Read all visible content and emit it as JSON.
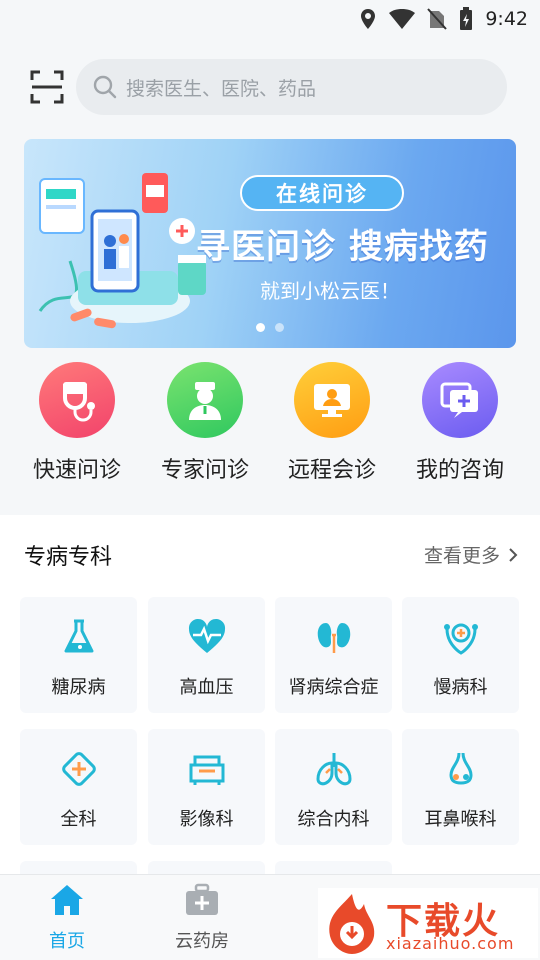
{
  "status_bar": {
    "time": "9:42"
  },
  "search": {
    "placeholder": "搜索医生、医院、药品"
  },
  "banner": {
    "tag": "在线问诊",
    "title": "寻医问诊 搜病找药",
    "subtitle": "就到小松云医！",
    "dots": 2,
    "active_dot": 0
  },
  "quick_actions": [
    {
      "label": "快速问诊",
      "icon": "stethoscope-icon",
      "color_from": "#ff7a7a",
      "color_to": "#f2436b"
    },
    {
      "label": "专家问诊",
      "icon": "doctor-icon",
      "color_from": "#7be36f",
      "color_to": "#2fc85f"
    },
    {
      "label": "远程会诊",
      "icon": "video-consult-icon",
      "color_from": "#ffcf3a",
      "color_to": "#ff9d12"
    },
    {
      "label": "我的咨询",
      "icon": "chat-plus-icon",
      "color_from": "#a98bff",
      "color_to": "#6b5cf0"
    }
  ],
  "specialty": {
    "title": "专病专科",
    "more": "查看更多",
    "items": [
      {
        "label": "糖尿病",
        "icon": "flask-icon"
      },
      {
        "label": "高血压",
        "icon": "heartbeat-icon"
      },
      {
        "label": "肾病综合症",
        "icon": "kidney-icon"
      },
      {
        "label": "慢病科",
        "icon": "chronic-icon"
      },
      {
        "label": "全科",
        "icon": "plus-diamond-icon"
      },
      {
        "label": "影像科",
        "icon": "imaging-icon"
      },
      {
        "label": "综合内科",
        "icon": "lungs-icon"
      },
      {
        "label": "耳鼻喉科",
        "icon": "nose-icon"
      }
    ]
  },
  "tabbar": {
    "items": [
      {
        "label": "首页",
        "icon": "home-icon",
        "active": true
      },
      {
        "label": "云药房",
        "icon": "medicine-box-icon",
        "active": false
      }
    ],
    "active_color": "#1aa7e6"
  },
  "watermark": {
    "text": "下载火",
    "url": "xiazaihuo.com"
  },
  "colors": {
    "accent": "#1aa7e6",
    "icon_teal": "#23b8d4"
  }
}
